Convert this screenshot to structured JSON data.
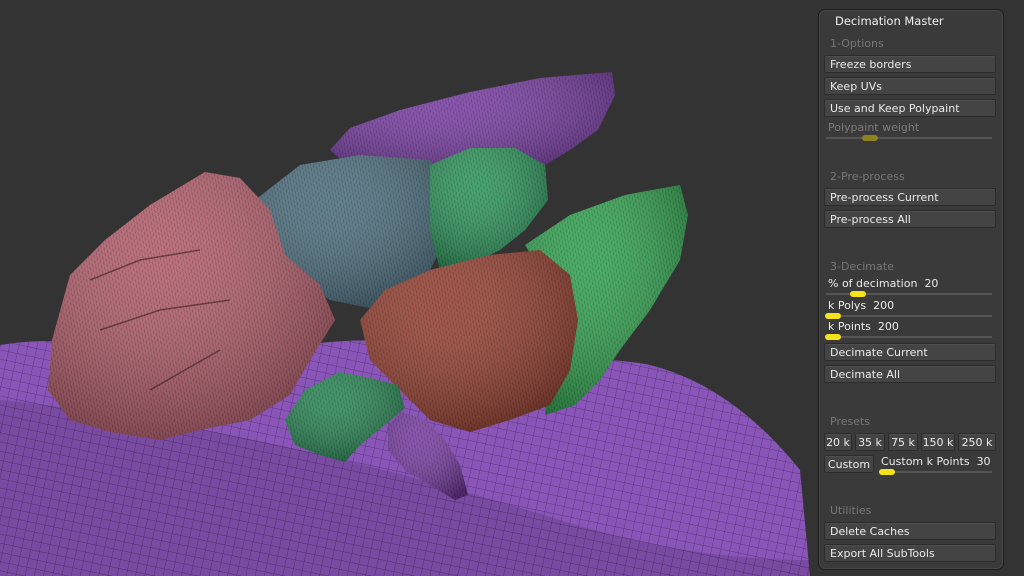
{
  "panel": {
    "title": "Decimation Master",
    "options": {
      "header": "1-Options",
      "freeze_borders": "Freeze borders",
      "keep_uvs": "Keep UVs",
      "use_keep_polypaint": "Use and Keep Polypaint",
      "polypaint_weight": {
        "label": "Polypaint weight",
        "value": 0.3
      }
    },
    "preprocess": {
      "header": "2-Pre-process",
      "current": "Pre-process Current",
      "all": "Pre-process All"
    },
    "decimate": {
      "header": "3-Decimate",
      "percent": {
        "label": "% of decimation",
        "value": "20"
      },
      "kpolys": {
        "label": "k Polys",
        "value": "200"
      },
      "kpoints": {
        "label": "k Points",
        "value": "200"
      },
      "current": "Decimate Current",
      "all": "Decimate All"
    },
    "presets": {
      "header": "Presets",
      "buttons": [
        "20 k",
        "35 k",
        "75 k",
        "150 k",
        "250 k"
      ],
      "custom": "Custom",
      "custom_kpoints": {
        "label": "Custom k Points",
        "value": "30"
      }
    },
    "utilities": {
      "header": "Utilities",
      "delete_caches": "Delete Caches",
      "export_all": "Export All SubTools"
    }
  },
  "viewport": {
    "background": "#333333",
    "colors": {
      "ground": "#8a55b8",
      "pink_rock": "#b8606e",
      "blue_rock": "#4f7282",
      "purple_rock": "#7c3fa8",
      "green_rock": "#2f9a5e",
      "bright_green_rock": "#33a852",
      "brown_rock": "#9a4232"
    }
  }
}
